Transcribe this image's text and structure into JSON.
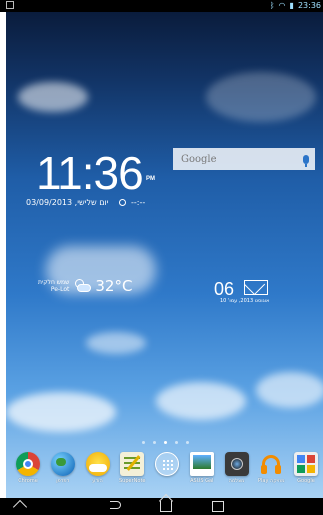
{
  "status_bar": {
    "time": "23:36"
  },
  "search": {
    "brand": "Google"
  },
  "clock": {
    "time": "11:36",
    "ampm": "PM"
  },
  "date": {
    "text": "יום שלישי, 03/09/2013",
    "alarm": "--:--"
  },
  "weather": {
    "location_line1": "שמש חלקית",
    "location_line2": "Pe-Lot",
    "temperature": "32°C"
  },
  "mail": {
    "count": "06",
    "sub": "אוגוסט 2013, עמו' 10"
  },
  "page_indicators": {
    "count": 5,
    "active_index": 3
  },
  "dock_apps": [
    {
      "label": "Chrome",
      "icon": "chrome-icon"
    },
    {
      "label": "דפדפן",
      "icon": "globe-icon"
    },
    {
      "label": "הודע",
      "icon": "weather-app-icon"
    },
    {
      "label": "SuperNote",
      "icon": "notepad-icon"
    },
    {
      "label": "",
      "icon": "apps-drawer-icon"
    },
    {
      "label": "ASUS Gal",
      "icon": "gallery-icon"
    },
    {
      "label": "מצלמה",
      "icon": "camera-icon"
    },
    {
      "label": "Play מוזיקה",
      "icon": "headphones-icon"
    },
    {
      "label": "Google",
      "icon": "google-folder-icon"
    }
  ],
  "colors": {
    "accent": "#2b74c8",
    "wallpaper_sky": "#2f79c9"
  }
}
